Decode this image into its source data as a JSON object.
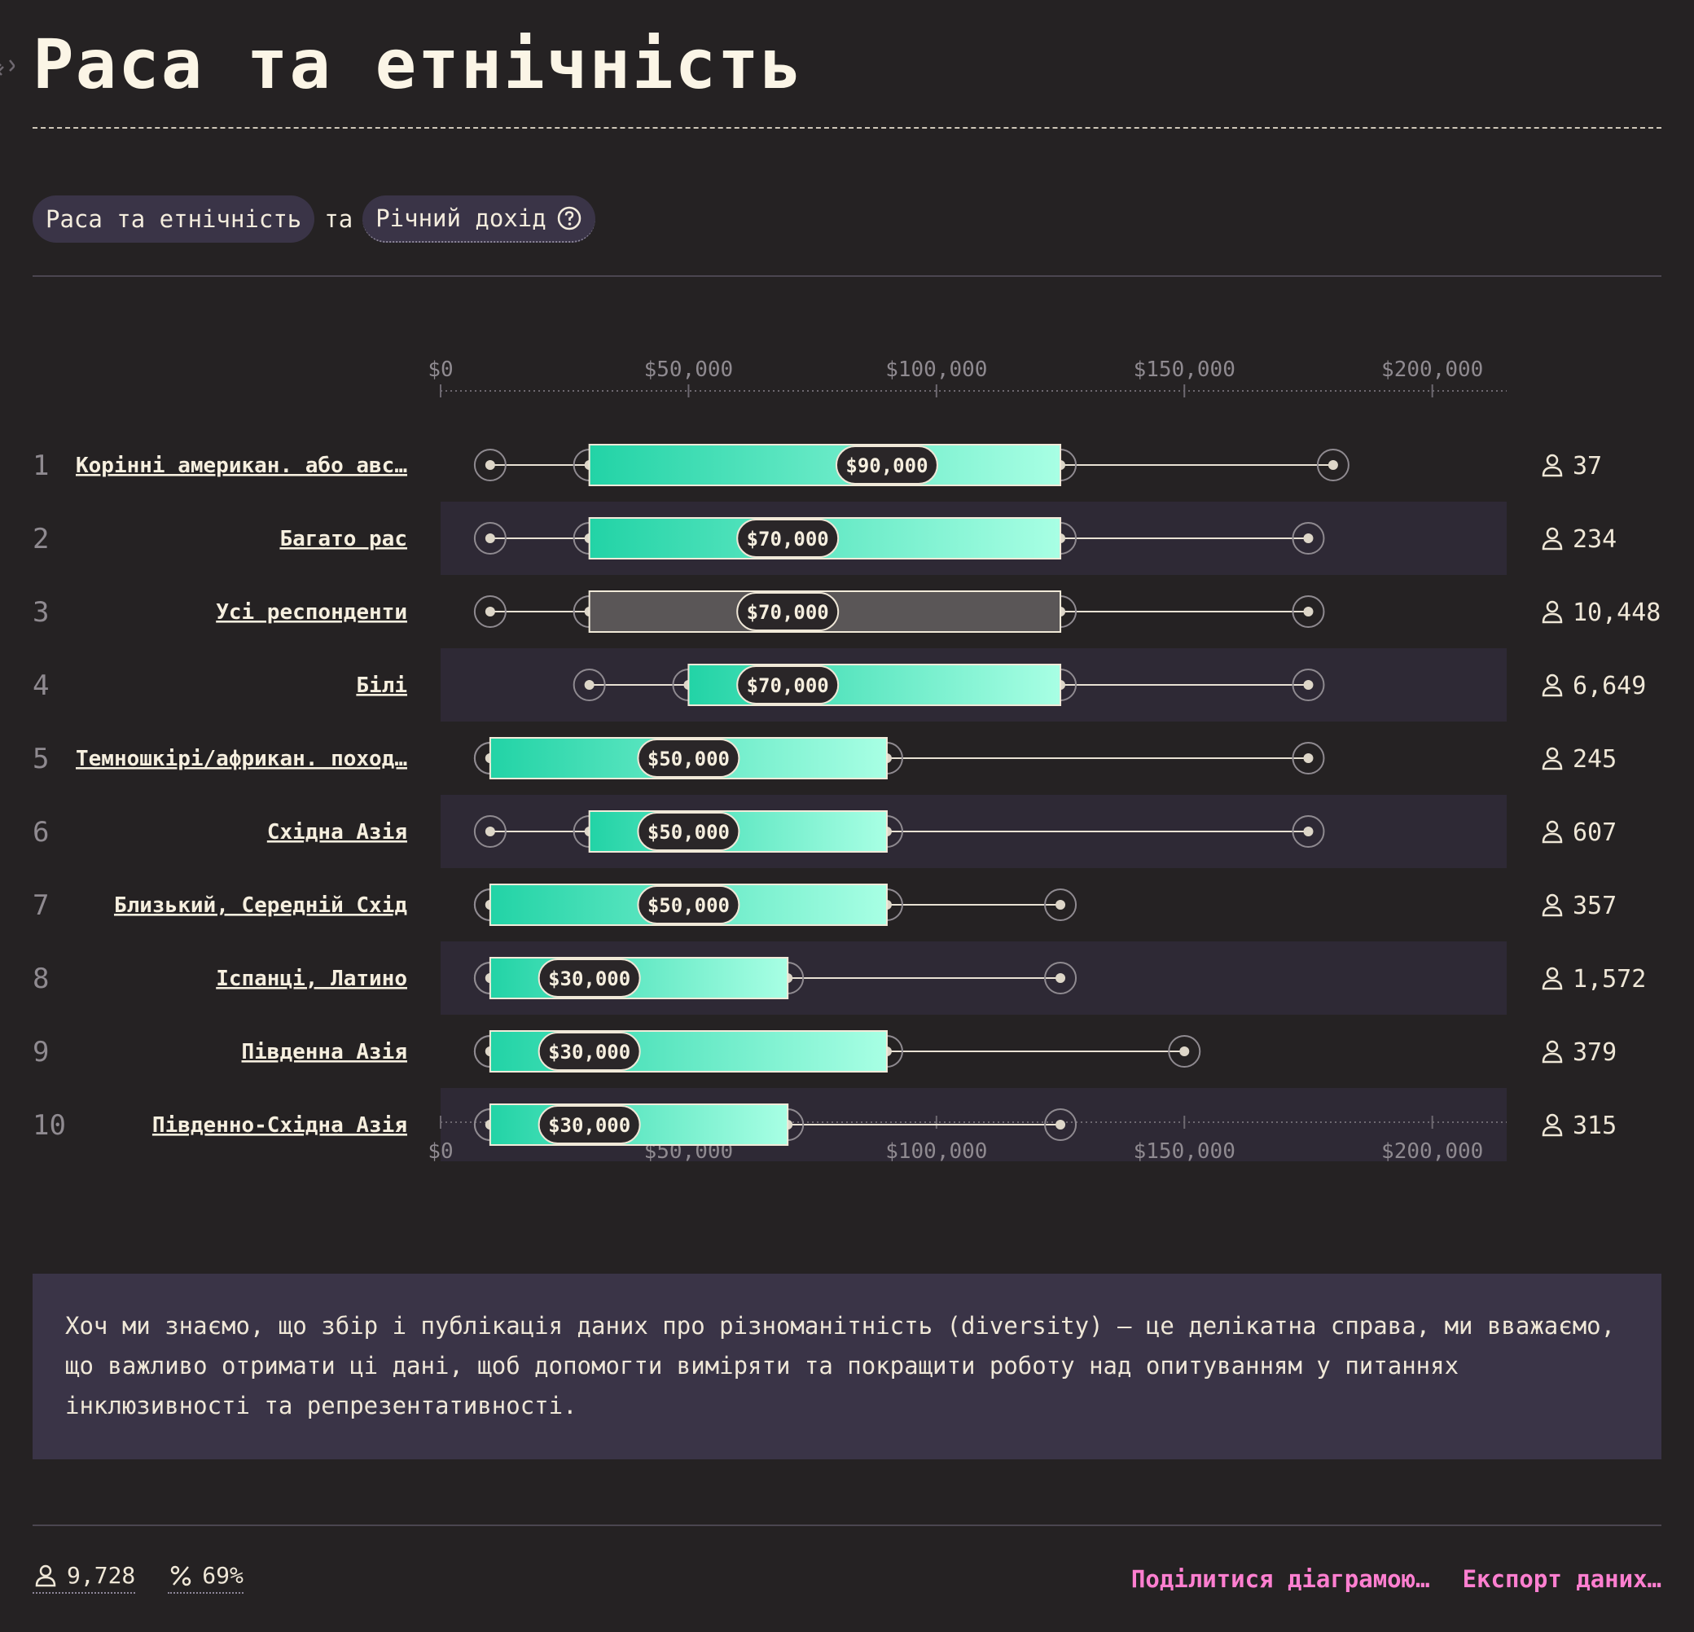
{
  "header": {
    "title": "Раса та етнічність"
  },
  "selectors": {
    "primary": "Раса та етнічність",
    "joiner": "та",
    "secondary": "Річний дохід"
  },
  "chart_data": {
    "type": "boxplot",
    "xlabel": "",
    "ylabel": "",
    "xlim": [
      0,
      215000
    ],
    "ticks": [
      0,
      50000,
      100000,
      150000,
      200000
    ],
    "tick_labels": [
      "$0",
      "$50,000",
      "$100,000",
      "$150,000",
      "$200,000"
    ],
    "rows": [
      {
        "rank": "1",
        "label": "Корінні американ. або авс…",
        "min": 10000,
        "q1": 30000,
        "median": 90000,
        "q3": 125000,
        "max": 180000,
        "median_label": "$90,000",
        "count": "37",
        "reference": false
      },
      {
        "rank": "2",
        "label": "Багато рас",
        "min": 10000,
        "q1": 30000,
        "median": 70000,
        "q3": 125000,
        "max": 175000,
        "median_label": "$70,000",
        "count": "234",
        "reference": false
      },
      {
        "rank": "3",
        "label": "Усі респонденти",
        "min": 10000,
        "q1": 30000,
        "median": 70000,
        "q3": 125000,
        "max": 175000,
        "median_label": "$70,000",
        "count": "10,448",
        "reference": true
      },
      {
        "rank": "4",
        "label": "Білі",
        "min": 30000,
        "q1": 50000,
        "median": 70000,
        "q3": 125000,
        "max": 175000,
        "median_label": "$70,000",
        "count": "6,649",
        "reference": false
      },
      {
        "rank": "5",
        "label": "Темношкірі/африкан. поход…",
        "min": 10000,
        "q1": 10000,
        "median": 50000,
        "q3": 90000,
        "max": 175000,
        "median_label": "$50,000",
        "count": "245",
        "reference": false
      },
      {
        "rank": "6",
        "label": "Східна Азія",
        "min": 10000,
        "q1": 30000,
        "median": 50000,
        "q3": 90000,
        "max": 175000,
        "median_label": "$50,000",
        "count": "607",
        "reference": false
      },
      {
        "rank": "7",
        "label": "Близький, Середній Схід",
        "min": 10000,
        "q1": 10000,
        "median": 50000,
        "q3": 90000,
        "max": 125000,
        "median_label": "$50,000",
        "count": "357",
        "reference": false
      },
      {
        "rank": "8",
        "label": "Іспанці, Латино",
        "min": 10000,
        "q1": 10000,
        "median": 30000,
        "q3": 70000,
        "max": 125000,
        "median_label": "$30,000",
        "count": "1,572",
        "reference": false
      },
      {
        "rank": "9",
        "label": "Південна Азія",
        "min": 10000,
        "q1": 10000,
        "median": 30000,
        "q3": 90000,
        "max": 150000,
        "median_label": "$30,000",
        "count": "379",
        "reference": false
      },
      {
        "rank": "10",
        "label": "Південно-Східна Азія",
        "min": 10000,
        "q1": 10000,
        "median": 30000,
        "q3": 70000,
        "max": 125000,
        "median_label": "$30,000",
        "count": "315",
        "reference": false
      }
    ],
    "colors": {
      "box_start": "#22d3a6",
      "box_end": "#a8ffe4",
      "reference_box": "#5a5657",
      "row_stripe": "#2e2935"
    }
  },
  "footnote": "Хоч ми знаємо, що збір і публікація даних про різноманітність (diversity) — це делікатна справа, ми вважаємо, що важливо отримати ці дані, щоб допомогти виміряти та покращити роботу над опитуванням у питаннях інклюзивності та репрезентативності.",
  "footer": {
    "respondents": "9,728",
    "percent": "69%",
    "share": "Поділитися діаграмою…",
    "export": "Експорт даних…"
  }
}
